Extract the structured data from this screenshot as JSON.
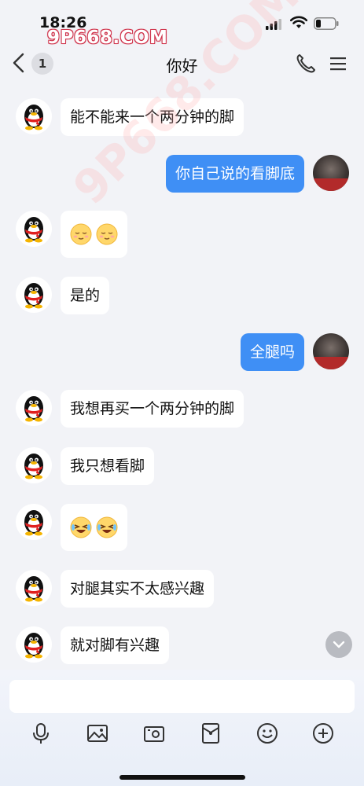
{
  "status_bar": {
    "time": "18:26"
  },
  "watermark": {
    "top": "9P668.COM",
    "diagonal": "9P668.COM"
  },
  "header": {
    "unread_count": "1",
    "title": "你好"
  },
  "messages": [
    {
      "side": "left",
      "type": "text",
      "text": "能不能来一个两分钟的脚"
    },
    {
      "side": "right",
      "type": "text",
      "text": "你自己说的看脚底"
    },
    {
      "side": "left",
      "type": "emoji",
      "emoji_icon": "relieved-face-icon"
    },
    {
      "side": "left",
      "type": "text",
      "text": "是的"
    },
    {
      "side": "right",
      "type": "text",
      "text": "全腿吗"
    },
    {
      "side": "left",
      "type": "text",
      "text": "我想再买一个两分钟的脚"
    },
    {
      "side": "left",
      "type": "text",
      "text": "我只想看脚"
    },
    {
      "side": "left",
      "type": "emoji",
      "emoji_icon": "laughing-tears-face-icon"
    },
    {
      "side": "left",
      "type": "text",
      "text": "对腿其实不太感兴趣"
    },
    {
      "side": "left",
      "type": "text",
      "text": "就对脚有兴趣"
    }
  ],
  "input": {
    "placeholder": ""
  },
  "toolbar": [
    "microphone-icon",
    "image-icon",
    "camera-icon",
    "red-packet-icon",
    "smile-icon",
    "plus-icon"
  ],
  "colors": {
    "accent": "#3f8ff5",
    "background": "#f2f3f7"
  }
}
